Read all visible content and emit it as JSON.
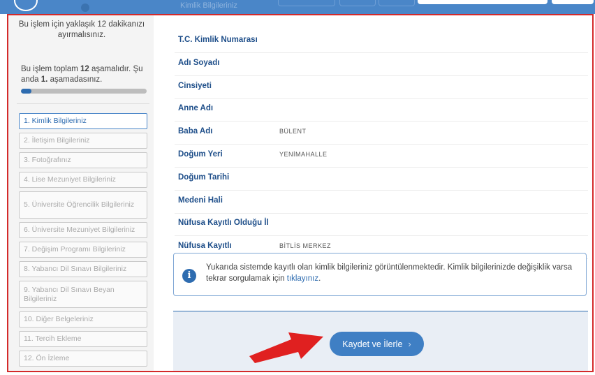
{
  "header": {
    "section_title": "Kimlik Bilgileriniz"
  },
  "sidebar": {
    "time_note": "Bu işlem için yaklaşık 12 dakikanızı ayırmalısınız.",
    "progress": {
      "text_before_total": "Bu işlem toplam ",
      "total": "12",
      "text_after_total": " aşamalıdır. Şu anda ",
      "current": "1.",
      "text_after_current": " aşamadasınız.",
      "fraction": 0.0833
    },
    "steps": [
      {
        "label": "1. Kimlik Bilgileriniz",
        "active": true
      },
      {
        "label": "2. İletişim Bilgileriniz",
        "active": false
      },
      {
        "label": "3. Fotoğrafınız",
        "active": false
      },
      {
        "label": "4. Lise Mezuniyet Bilgileriniz",
        "active": false
      },
      {
        "label": "5. Üniversite Öğrencilik Bilgileriniz",
        "active": false
      },
      {
        "label": "6. Üniversite Mezuniyet Bilgileriniz",
        "active": false
      },
      {
        "label": "7. Değişim Programı Bilgileriniz",
        "active": false
      },
      {
        "label": "8. Yabancı Dil Sınavı Bilgileriniz",
        "active": false
      },
      {
        "label": "9. Yabancı Dil Sınavı Beyan Bilgileriniz",
        "active": false
      },
      {
        "label": "10. Diğer Belgeleriniz",
        "active": false
      },
      {
        "label": "11. Tercih Ekleme",
        "active": false
      },
      {
        "label": "12. Ön İzleme",
        "active": false
      }
    ]
  },
  "identity": {
    "rows": [
      {
        "label": "T.C. Kimlik Numarası",
        "value": ""
      },
      {
        "label": "Adı Soyadı",
        "value": ""
      },
      {
        "label": "Cinsiyeti",
        "value": ""
      },
      {
        "label": "Anne Adı",
        "value": ""
      },
      {
        "label": "Baba Adı",
        "value": "BÜLENT"
      },
      {
        "label": "Doğum Yeri",
        "value": "YENİMAHALLE"
      },
      {
        "label": "Doğum Tarihi",
        "value": ""
      },
      {
        "label": "Medeni Hali",
        "value": ""
      },
      {
        "label": "Nüfusa Kayıtlı Olduğu İl",
        "value": ""
      },
      {
        "label": "Nüfusa Kayıtlı",
        "value": "BİTLİS MERKEZ"
      }
    ]
  },
  "info": {
    "icon": "info-icon",
    "text": "Yukarıda sistemde kayıtlı olan kimlik bilgileriniz görüntülenmektedir. Kimlik bilgilerinizde değişiklik varsa tekrar sorgulamak için ",
    "link": "tıklayınız",
    "text_end": "."
  },
  "actions": {
    "save_label": "Kaydet ve İlerle",
    "save_icon": "chevron-right-icon"
  },
  "colors": {
    "accent": "#2e6cb0",
    "annotation": "#e02020"
  }
}
